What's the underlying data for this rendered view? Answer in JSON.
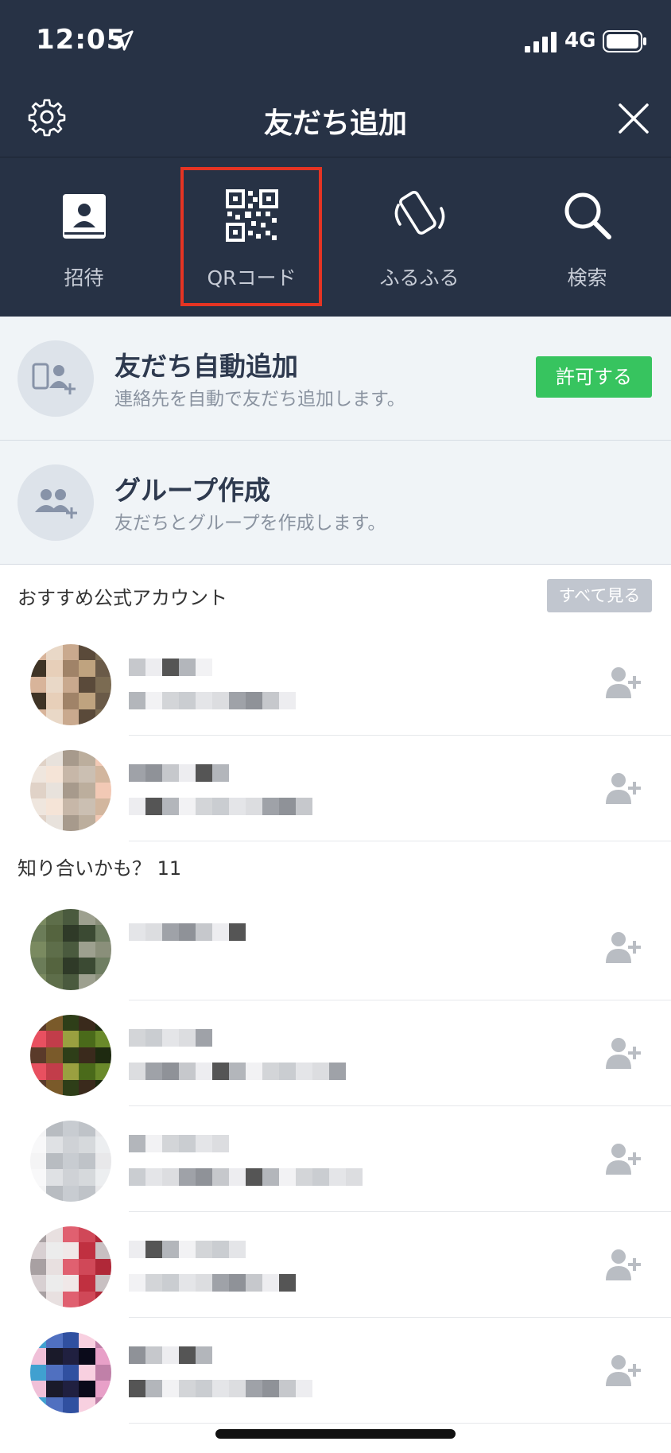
{
  "status_bar": {
    "time": "12:05",
    "network": "4G"
  },
  "header": {
    "title": "友だち追加"
  },
  "tabs": [
    {
      "label": "招待",
      "icon": "invite-icon"
    },
    {
      "label": "QRコード",
      "icon": "qr-code-icon",
      "highlighted": true
    },
    {
      "label": "ふるふる",
      "icon": "shake-phone-icon"
    },
    {
      "label": "検索",
      "icon": "search-icon"
    }
  ],
  "auto_add": {
    "title": "友だち自動追加",
    "subtitle": "連絡先を自動で友だち追加します。",
    "button": "許可する"
  },
  "group_create": {
    "title": "グループ作成",
    "subtitle": "友だちとグループを作成します。"
  },
  "recommended": {
    "heading": "おすすめ公式アカウント",
    "see_all": "すべて見る"
  },
  "maybe_know": {
    "heading": "知り合いかも？ 11"
  },
  "colors": {
    "header_bg": "#273245",
    "section_bg": "#f0f4f7",
    "accent_green": "#37c45f",
    "highlight_red": "#e53423"
  }
}
